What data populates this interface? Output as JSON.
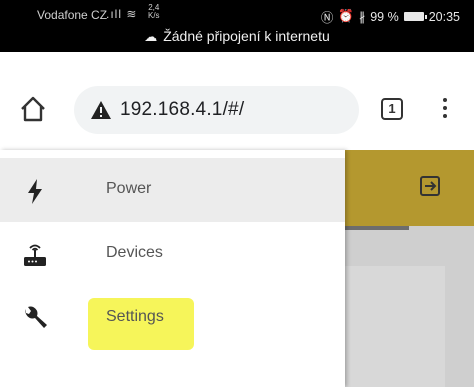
{
  "status_bar": {
    "carrier": "Vodafone CZ",
    "speed_value": "2,4",
    "speed_unit": "K/s",
    "battery": "99 %",
    "time": "20:35"
  },
  "offline_banner": {
    "text": "Žádné připojení k internetu"
  },
  "browser": {
    "url": "192.168.4.1/#/",
    "tab_count": "1"
  },
  "drawer": {
    "items": [
      {
        "label": "Power",
        "icon": "lightning-icon",
        "active": true
      },
      {
        "label": "Devices",
        "icon": "router-icon",
        "active": false
      },
      {
        "label": "Settings",
        "icon": "wrench-icon",
        "active": false
      }
    ]
  },
  "colors": {
    "app_bar": "#b4982f",
    "highlight": "#f5f33d"
  }
}
